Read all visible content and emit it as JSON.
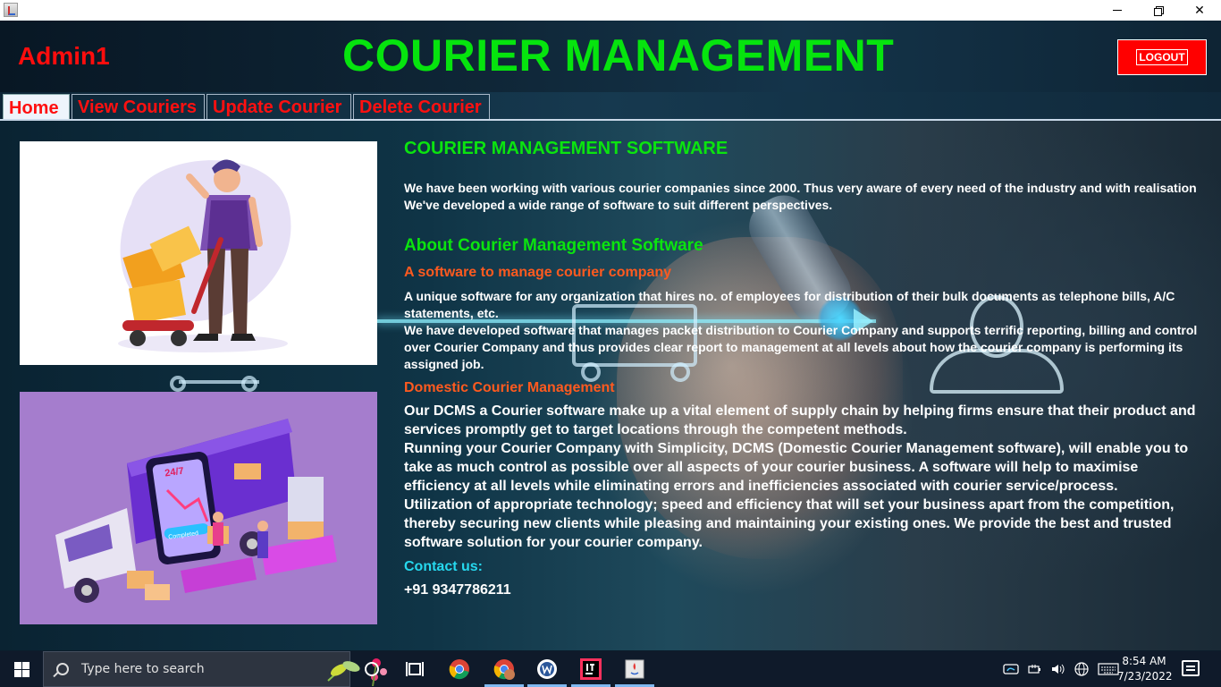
{
  "window": {
    "minimize_label": "—",
    "maximize_label": "",
    "close_label": "✕"
  },
  "header": {
    "user": "Admin1",
    "title": "COURIER MANAGEMENT",
    "logout_label": "LOGOUT"
  },
  "tabs": [
    {
      "label": "Home",
      "active": true
    },
    {
      "label": "View Couriers",
      "active": false
    },
    {
      "label": "Update Courier",
      "active": false
    },
    {
      "label": "Delete Courier",
      "active": false
    }
  ],
  "content": {
    "heading1": "COURIER MANAGEMENT SOFTWARE",
    "intro": "We have been working with various courier companies since 2000. Thus very aware of every need of the industry and with realisation We've developed a wide range of software to suit different perspectives.",
    "heading2": "About Courier Management Software",
    "sub1": "A software to manage courier company",
    "para1": "A unique software for any organization that hires no. of employees for distribution of their bulk documents as telephone bills, A/C statements, etc.",
    "para2": "We have developed software that manages packet distribution to Courier Company and supports terrific reporting, billing and control over Courier Company and thus provides clear report to management at all levels about how the courier company is performing its assigned job.",
    "sub2": "Domestic Courier Management",
    "para3": "Our DCMS a Courier software make up a vital element of supply chain by helping firms ensure that their product and services promptly get to target locations through the competent methods.",
    "para4": "Running your Courier Company with Simplicity, DCMS (Domestic Courier Management software), will enable you to take as much control as possible over all aspects of your courier business. A software will help to maximise efficiency at all levels while eliminating errors and inefficiencies associated with courier service/process.",
    "para5": "Utilization of appropriate technology; speed and efficiency that will set your business apart from the competition, thereby securing new clients while pleasing and maintaining your existing ones. We provide the best and trusted software solution for your courier company.",
    "contact_label": "Contact us:",
    "phone": "+91 9347786211",
    "illustration2_text": "24/7",
    "illustration2_badge": "Completed"
  },
  "taskbar": {
    "search_placeholder": "Type here to search",
    "time": "8:54 AM",
    "date": "7/23/2022"
  },
  "colors": {
    "title_green": "#06e40e",
    "tab_red": "#ff1010",
    "orange": "#ff5a1f",
    "cyan": "#26d8ee",
    "logout_red": "#ff0000"
  }
}
